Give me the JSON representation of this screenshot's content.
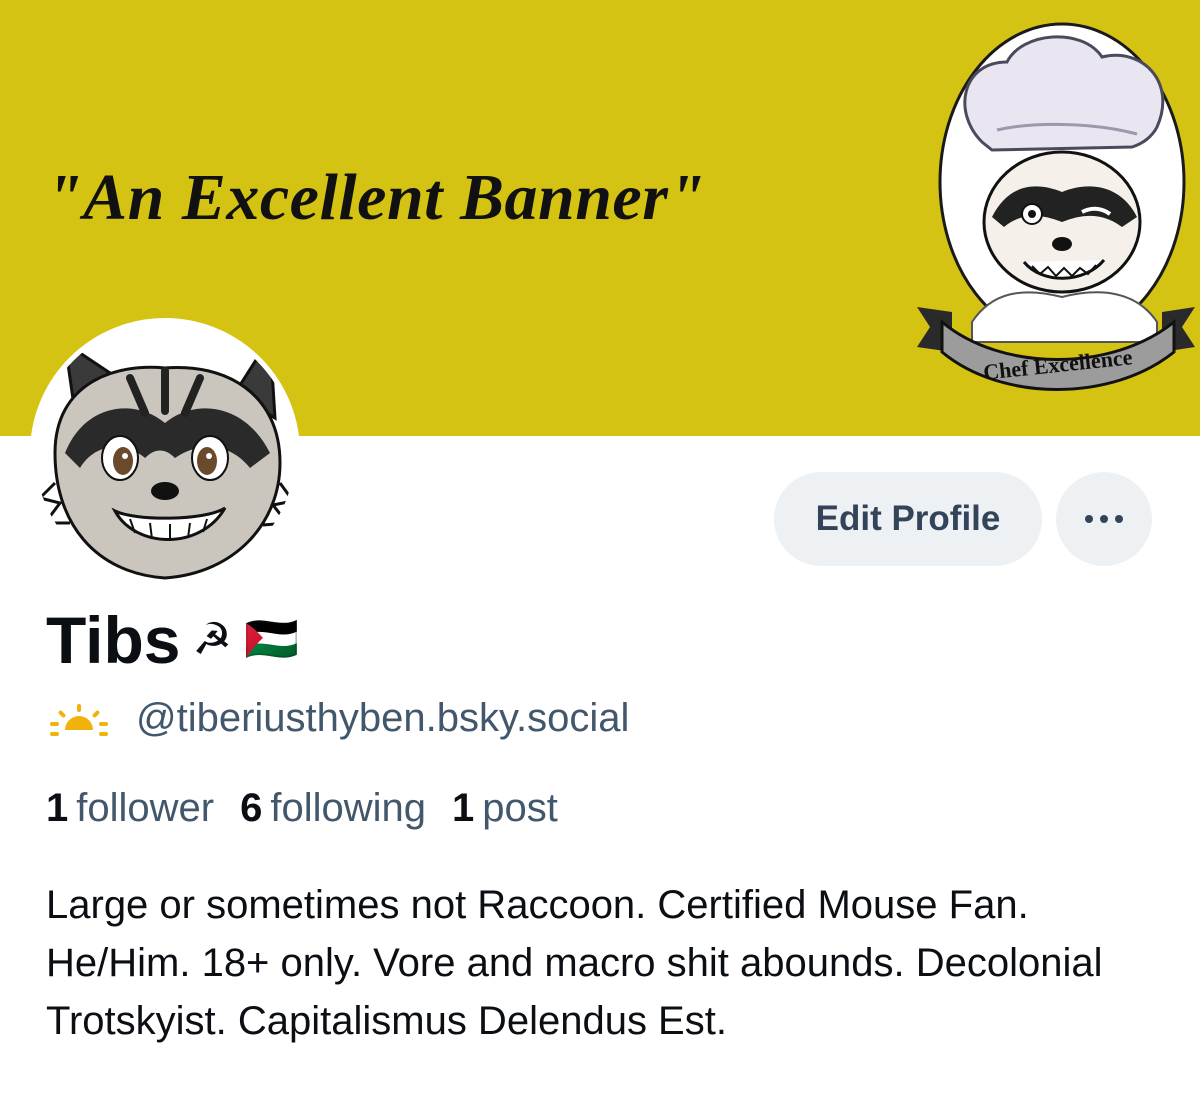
{
  "banner": {
    "text": "\"An Excellent Banner\"",
    "badge_text": "Chef Excellence",
    "color": "#d5c313"
  },
  "profile": {
    "display_name": "Tibs",
    "name_emojis": [
      "☭",
      "🇵🇸"
    ],
    "handle": "@tiberiusthyben.bsky.social",
    "handle_icon": "sun-icon",
    "bio": "Large or sometimes not Raccoon. Certified Mouse Fan. He/Him. 18+ only. Vore and macro shit abounds. Decolonial Trotskyist. Capitalismus Delendus Est."
  },
  "actions": {
    "edit_label": "Edit Profile",
    "more_icon": "ellipsis-icon"
  },
  "stats": {
    "followers_count": "1",
    "followers_label": "follower",
    "following_count": "6",
    "following_label": "following",
    "posts_count": "1",
    "posts_label": "post"
  },
  "colors": {
    "button_bg": "#eef1f4",
    "muted_text": "#42576c",
    "text": "#0b0f14"
  }
}
